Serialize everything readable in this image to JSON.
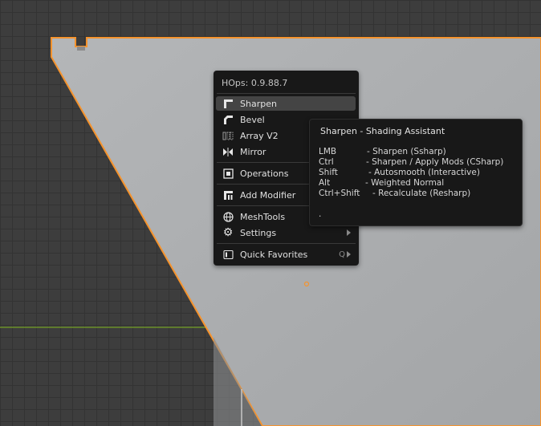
{
  "menu": {
    "title": "HOps: 0.9.88.7",
    "items": [
      {
        "label": "Sharpen",
        "icon": "sharpen-icon"
      },
      {
        "label": "Bevel",
        "icon": "bevel-icon"
      },
      {
        "label": "Array V2",
        "icon": "array-icon"
      },
      {
        "label": "Mirror",
        "icon": "mirror-icon"
      },
      {
        "label": "Operations",
        "icon": "operations-icon",
        "submenu": true
      },
      {
        "label": "Add Modifier",
        "icon": "add-modifier-icon",
        "submenu": true
      },
      {
        "label": "MeshTools",
        "icon": "globe-icon",
        "submenu": true
      },
      {
        "label": "Settings",
        "icon": "gear-icon",
        "submenu": true
      },
      {
        "label": "Quick Favorites",
        "icon": "favorites-icon",
        "shortcut": "Q",
        "submenu": true
      }
    ]
  },
  "tooltip": {
    "title": "Sharpen  -  Shading Assistant",
    "rows": [
      {
        "key": "LMB",
        "desc": "-  Sharpen (Ssharp)"
      },
      {
        "key": "Ctrl",
        "desc": "-  Sharpen / Apply Mods (CSharp)"
      },
      {
        "key": "Shift",
        "desc": "-  Autosmooth (Interactive)"
      },
      {
        "key": "Alt",
        "desc": "-  Weighted Normal"
      },
      {
        "key": "Ctrl+Shift",
        "desc": "-  Recalculate (Resharp)"
      }
    ],
    "footer": "."
  },
  "colors": {
    "viewport_bg": "#3d3d3d",
    "grid_line": "#333333",
    "object_face": "#acaeb0",
    "selection_outline": "#f5932d",
    "x_axis": "#6a8e28",
    "menu_bg": "#181818",
    "menu_highlight": "#444444"
  }
}
